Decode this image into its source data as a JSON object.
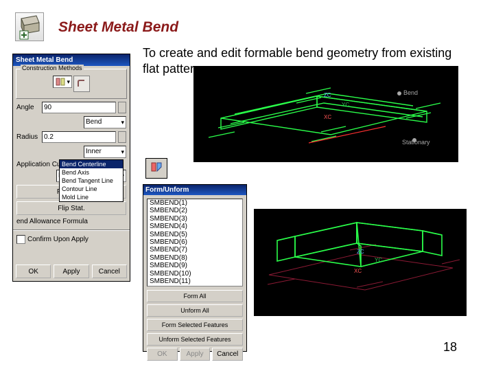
{
  "title": "Sheet Metal Bend",
  "description": "To create and edit formable bend geometry from existing flat pattern.",
  "page_number": "18",
  "dlg1": {
    "title": "Sheet Metal Bend",
    "grp_methods": "Construction Methods",
    "angle_lbl": "Angle",
    "angle_val": "90",
    "bend_sel": "Bend",
    "radius_lbl": "Radius",
    "radius_val": "0.2",
    "inner_sel": "Inner",
    "curve_type_lbl": "Application Curve Type",
    "curve_type_sel": "Bend Centerline",
    "dd_items": [
      "Bend Centerline",
      "Bend Axis",
      "Bend Tangent Line",
      "Contour Line",
      "Mold Line"
    ],
    "flip_bend": "Flip Bend",
    "flip_stat": "Flip Stat.",
    "baf_lbl": "end Allowance Formula",
    "confirm_lbl": "Confirm Upon Apply",
    "ok": "OK",
    "apply": "Apply",
    "cancel": "Cancel"
  },
  "cad1": {
    "zc": "ZC",
    "yc": "YC",
    "xc": "XC",
    "bend_lbl": "Bend",
    "stat_lbl": "Stationary"
  },
  "cad2": {
    "zc": "ZC",
    "yc": "YC",
    "xc": "XC"
  },
  "dlg2": {
    "title": "Form/Unform",
    "items": [
      "SMBEND(1)",
      "SMBEND(2)",
      "SMBEND(3)",
      "SMBEND(4)",
      "SMBEND(5)",
      "SMBEND(6)",
      "SMBEND(7)",
      "SMBEND(8)",
      "SMBEND(9)",
      "SMBEND(10)",
      "SMBEND(11)"
    ],
    "form_all": "Form All",
    "unform_all": "Unform All",
    "form_sel": "Form Selected Features",
    "unform_sel": "Unform Selected Features",
    "ok": "OK",
    "apply": "Apply",
    "cancel": "Cancel"
  }
}
